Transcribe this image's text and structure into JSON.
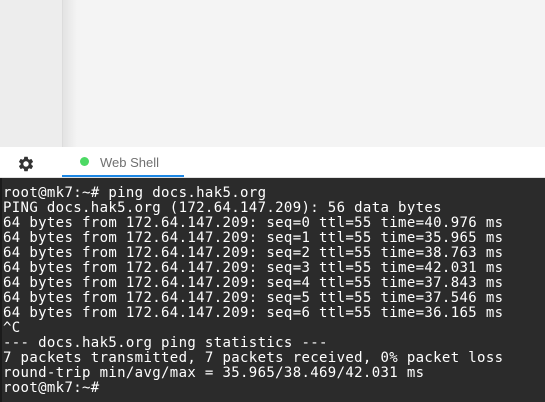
{
  "tabs": [
    {
      "label": "Web Shell",
      "status_color": "#4cd964",
      "active": true
    }
  ],
  "toolbar": {
    "settings_icon": "gear-icon"
  },
  "terminal": {
    "lines": [
      "root@mk7:~# ping docs.hak5.org",
      "PING docs.hak5.org (172.64.147.209): 56 data bytes",
      "64 bytes from 172.64.147.209: seq=0 ttl=55 time=40.976 ms",
      "64 bytes from 172.64.147.209: seq=1 ttl=55 time=35.965 ms",
      "64 bytes from 172.64.147.209: seq=2 ttl=55 time=38.763 ms",
      "64 bytes from 172.64.147.209: seq=3 ttl=55 time=42.031 ms",
      "64 bytes from 172.64.147.209: seq=4 ttl=55 time=37.843 ms",
      "64 bytes from 172.64.147.209: seq=5 ttl=55 time=37.546 ms",
      "64 bytes from 172.64.147.209: seq=6 ttl=55 time=36.165 ms",
      "^C",
      "--- docs.hak5.org ping statistics ---",
      "7 packets transmitted, 7 packets received, 0% packet loss",
      "round-trip min/avg/max = 35.965/38.469/42.031 ms",
      "root@mk7:~#"
    ]
  }
}
